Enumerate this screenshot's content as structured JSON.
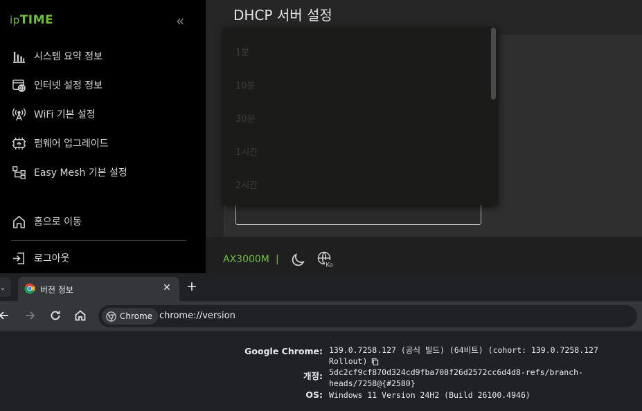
{
  "router": {
    "logo": {
      "prefix": "ip",
      "suffix": "TIME"
    },
    "collapse_icon": "«",
    "menu": [
      {
        "label": "시스템 요약 정보",
        "icon": "bar-chart-icon"
      },
      {
        "label": "인터넷 설정 정보",
        "icon": "internet-settings-icon"
      },
      {
        "label": "WiFi 기본 설정",
        "icon": "wifi-antenna-icon"
      },
      {
        "label": "펌웨어 업그레이드",
        "icon": "firmware-upgrade-icon"
      },
      {
        "label": "Easy Mesh 기본 설정",
        "icon": "mesh-network-icon"
      }
    ],
    "home_label": "홈으로 이동",
    "logout_label": "로그아웃",
    "page_title": "DHCP 서버 설정",
    "lease_options": [
      "1분",
      "10분",
      "30분",
      "1시간",
      "2시간"
    ],
    "model": "AX3000M",
    "divider": "|",
    "language_badge": "Ko",
    "accent_color": "#6fbf3e"
  },
  "chrome": {
    "tab_title": "버전 정보",
    "tab_close": "✕",
    "new_tab": "+",
    "chip_label": "Chrome",
    "url": "chrome://version",
    "rows": [
      {
        "label": "Google Chrome:",
        "value": "139.0.7258.127 (공식 빌드) (64비트) (cohort: 139.0.7258.127 Rollout)"
      },
      {
        "label": "개정:",
        "value": "5dc2cf9cf870d324cd9fba708f26d2572cc6d4d8-refs/branch-heads/7258@{#2580}"
      },
      {
        "label": "OS:",
        "value": "Windows 11 Version 24H2 (Build 26100.4946)"
      }
    ]
  }
}
